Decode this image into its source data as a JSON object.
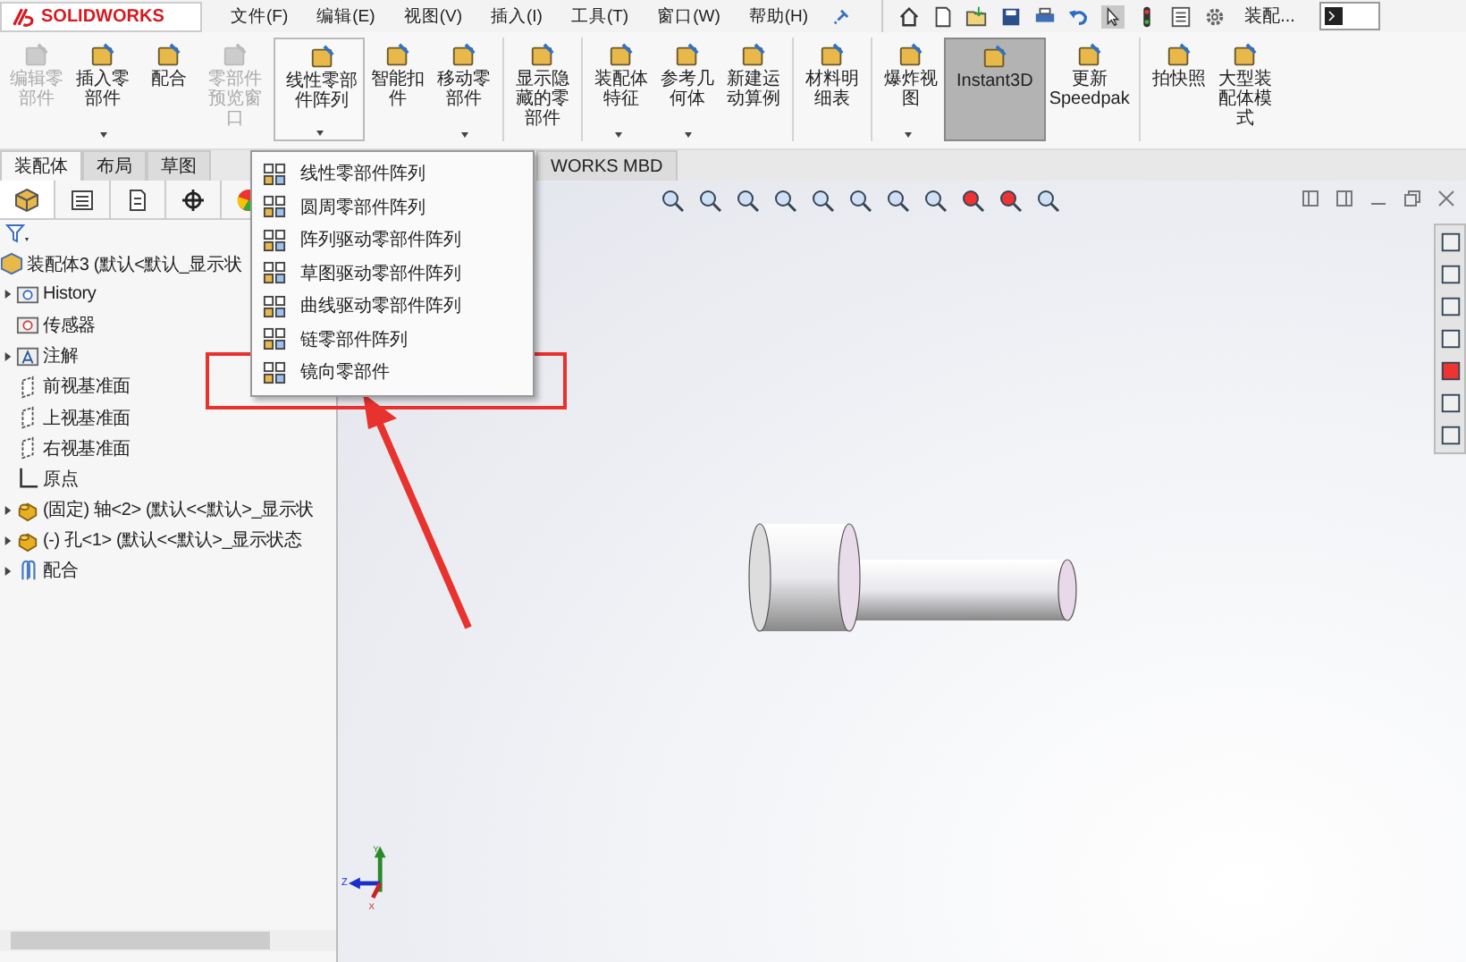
{
  "app": {
    "logo": "SOLIDWORKS"
  },
  "menu_bar": [
    "文件(F)",
    "编辑(E)",
    "视图(V)",
    "插入(I)",
    "工具(T)",
    "窗口(W)",
    "帮助(H)"
  ],
  "quick_access": {
    "document": "装配..."
  },
  "ribbon": [
    {
      "label": "编辑零部件",
      "disabled": true,
      "dropdown": false,
      "open": false,
      "selected": false,
      "separator_before": false
    },
    {
      "label": "插入零部件",
      "disabled": false,
      "dropdown": true,
      "open": false,
      "selected": false,
      "separator_before": false
    },
    {
      "label": "配合",
      "disabled": false,
      "dropdown": false,
      "open": false,
      "selected": false,
      "separator_before": false
    },
    {
      "label": "零部件预览窗口",
      "disabled": true,
      "dropdown": false,
      "open": false,
      "selected": false,
      "separator_before": false
    },
    {
      "label": "线性零部件阵列",
      "disabled": false,
      "dropdown": true,
      "open": true,
      "selected": false,
      "separator_before": true
    },
    {
      "label": "智能扣件",
      "disabled": false,
      "dropdown": false,
      "open": false,
      "selected": false,
      "separator_before": false
    },
    {
      "label": "移动零部件",
      "disabled": false,
      "dropdown": true,
      "open": false,
      "selected": false,
      "separator_before": false
    },
    {
      "label": "显示隐藏的零部件",
      "disabled": false,
      "dropdown": false,
      "open": false,
      "selected": false,
      "separator_before": true
    },
    {
      "label": "装配体特征",
      "disabled": false,
      "dropdown": true,
      "open": false,
      "selected": false,
      "separator_before": true
    },
    {
      "label": "参考几何体",
      "disabled": false,
      "dropdown": true,
      "open": false,
      "selected": false,
      "separator_before": false
    },
    {
      "label": "新建运动算例",
      "disabled": false,
      "dropdown": false,
      "open": false,
      "selected": false,
      "separator_before": false
    },
    {
      "label": "材料明细表",
      "disabled": false,
      "dropdown": false,
      "open": false,
      "selected": false,
      "separator_before": true
    },
    {
      "label": "爆炸视图",
      "disabled": false,
      "dropdown": true,
      "open": false,
      "selected": false,
      "separator_before": true
    },
    {
      "label": "Instant3D",
      "disabled": false,
      "dropdown": false,
      "open": false,
      "selected": true,
      "separator_before": false
    },
    {
      "label": "更新 Speedpak",
      "disabled": false,
      "dropdown": false,
      "open": false,
      "selected": false,
      "separator_before": false
    },
    {
      "label": "拍快照",
      "disabled": false,
      "dropdown": false,
      "open": false,
      "selected": false,
      "separator_before": true
    },
    {
      "label": "大型装配体模式",
      "disabled": false,
      "dropdown": false,
      "open": false,
      "selected": false,
      "separator_before": false
    }
  ],
  "tabs": [
    {
      "label": "装配体",
      "selected": true
    },
    {
      "label": "布局",
      "selected": false
    },
    {
      "label": "草图",
      "selected": false
    }
  ],
  "tab_partial": "WORKS MBD",
  "dropdown_menu": [
    "线性零部件阵列",
    "圆周零部件阵列",
    "阵列驱动零部件阵列",
    "草图驱动零部件阵列",
    "曲线驱动零部件阵列",
    "链零部件阵列",
    "镜向零部件"
  ],
  "feature_tree": {
    "root": {
      "label": "装配体3  (默认<默认_显示状",
      "children": [
        {
          "label": "History",
          "kind": "history",
          "expandable": true
        },
        {
          "label": "传感器",
          "kind": "sensor",
          "expandable": false
        },
        {
          "label": "注解",
          "kind": "annotation",
          "expandable": true
        },
        {
          "label": "前视基准面",
          "kind": "plane",
          "expandable": false
        },
        {
          "label": "上视基准面",
          "kind": "plane",
          "expandable": false
        },
        {
          "label": "右视基准面",
          "kind": "plane",
          "expandable": false
        },
        {
          "label": "原点",
          "kind": "origin",
          "expandable": false
        },
        {
          "label": "(固定) 轴<2> (默认<<默认>_显示状",
          "kind": "part",
          "expandable": true
        },
        {
          "label": "(-) 孔<1> (默认<<默认>_显示状态",
          "kind": "part",
          "expandable": true
        },
        {
          "label": "配合",
          "kind": "mates",
          "expandable": true
        }
      ]
    }
  },
  "triad": {
    "x": "X",
    "y": "Y",
    "z": "Z"
  }
}
